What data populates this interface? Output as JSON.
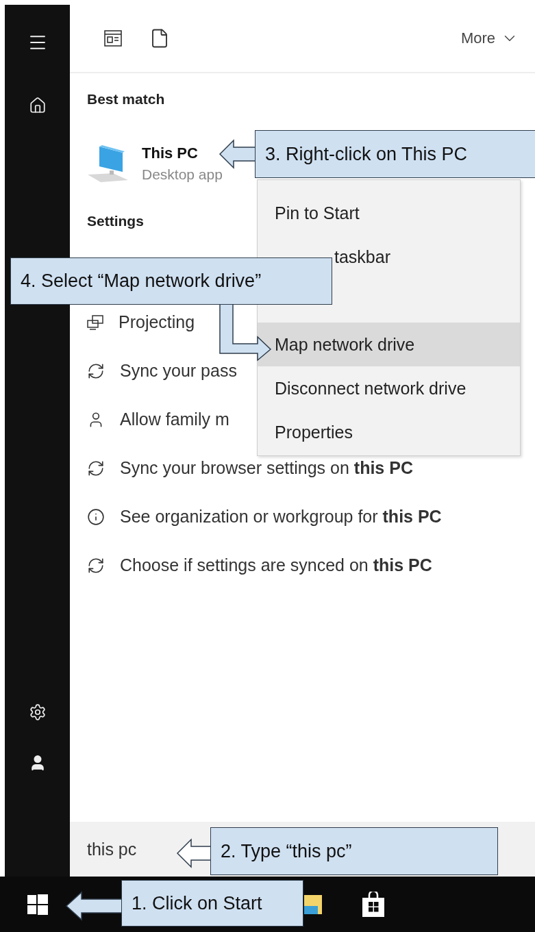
{
  "toolbar": {
    "more": "More"
  },
  "best_match": {
    "heading": "Best match",
    "title": "This PC",
    "subtitle": "Desktop app"
  },
  "settings": {
    "heading": "Settings",
    "items": [
      {
        "kind": "project",
        "text": "Projecting"
      },
      {
        "kind": "sync",
        "text": "Sync your pass"
      },
      {
        "kind": "person",
        "text": "Allow family m"
      },
      {
        "kind": "sync",
        "text": "Sync your browser settings on **this PC**"
      },
      {
        "kind": "info",
        "text": "See organization or workgroup for **this PC**"
      },
      {
        "kind": "sync",
        "text": "Choose if settings are synced on **this PC**"
      }
    ]
  },
  "context_menu": [
    {
      "label": "Pin to Start",
      "selected": false,
      "cut_left": false
    },
    {
      "label": "taskbar",
      "selected": false,
      "cut_left": true
    },
    {
      "selected": false
    },
    {
      "label": "Map network drive",
      "selected": true,
      "cut_left": false
    },
    {
      "label": "Disconnect network drive",
      "selected": false,
      "cut_left": false
    },
    {
      "label": "Properties",
      "selected": false,
      "cut_left": false
    }
  ],
  "search": {
    "value": "this pc"
  },
  "callouts": [
    "3. Right-click on This PC",
    "4. Select “Map network drive”",
    "2. Type “this pc”",
    "1. Click on Start"
  ]
}
